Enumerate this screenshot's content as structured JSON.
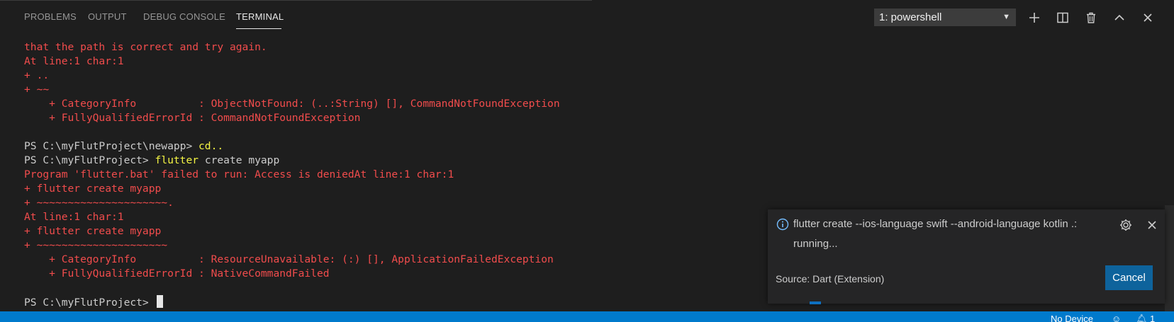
{
  "panel": {
    "tabs": [
      {
        "label": "PROBLEMS"
      },
      {
        "label": "OUTPUT"
      },
      {
        "label": "DEBUG CONSOLE"
      },
      {
        "label": "TERMINAL",
        "active": true
      }
    ],
    "terminal_select": {
      "value": "1: powershell"
    },
    "toolbar_icons": [
      "plus-icon",
      "split-icon",
      "trash-icon",
      "chevron-up-icon",
      "close-icon"
    ]
  },
  "terminal": {
    "lines": [
      {
        "parts": [
          {
            "text": "that the path is correct and try again.",
            "color": "red"
          }
        ]
      },
      {
        "parts": [
          {
            "text": "At line:1 char:1",
            "color": "red"
          }
        ]
      },
      {
        "parts": [
          {
            "text": "+ ..",
            "color": "red"
          }
        ]
      },
      {
        "parts": [
          {
            "text": "+ ~~",
            "color": "red"
          }
        ]
      },
      {
        "parts": [
          {
            "text": "    + CategoryInfo          : ObjectNotFound: (..:String) [], CommandNotFoundException",
            "color": "red"
          }
        ]
      },
      {
        "parts": [
          {
            "text": "    + FullyQualifiedErrorId : CommandNotFoundException",
            "color": "red"
          }
        ]
      },
      {
        "parts": [
          {
            "text": "",
            "color": "white"
          }
        ]
      },
      {
        "parts": [
          {
            "text": "PS C:\\myFlutProject\\newapp> ",
            "color": "white"
          },
          {
            "text": "cd..",
            "color": "yellow"
          }
        ]
      },
      {
        "parts": [
          {
            "text": "PS C:\\myFlutProject> ",
            "color": "white"
          },
          {
            "text": "flutter",
            "color": "yellow"
          },
          {
            "text": " create myapp",
            "color": "white"
          }
        ]
      },
      {
        "parts": [
          {
            "text": "Program 'flutter.bat' failed to run: Access is deniedAt line:1 char:1",
            "color": "red"
          }
        ]
      },
      {
        "parts": [
          {
            "text": "+ flutter create myapp",
            "color": "red"
          }
        ]
      },
      {
        "parts": [
          {
            "text": "+ ~~~~~~~~~~~~~~~~~~~~~.",
            "color": "red"
          }
        ]
      },
      {
        "parts": [
          {
            "text": "At line:1 char:1",
            "color": "red"
          }
        ]
      },
      {
        "parts": [
          {
            "text": "+ flutter create myapp",
            "color": "red"
          }
        ]
      },
      {
        "parts": [
          {
            "text": "+ ~~~~~~~~~~~~~~~~~~~~~",
            "color": "red"
          }
        ]
      },
      {
        "parts": [
          {
            "text": "    + CategoryInfo          : ResourceUnavailable: (:) [], ApplicationFailedException",
            "color": "red"
          }
        ]
      },
      {
        "parts": [
          {
            "text": "    + FullyQualifiedErrorId : NativeCommandFailed",
            "color": "red"
          }
        ]
      },
      {
        "parts": [
          {
            "text": "",
            "color": "white"
          }
        ]
      },
      {
        "parts": [
          {
            "text": "PS C:\\myFlutProject> ",
            "color": "white"
          }
        ],
        "cursor": true
      }
    ]
  },
  "notification": {
    "icon": "info-icon",
    "message": "flutter create --ios-language swift --android-language kotlin .:",
    "message_cont": "running...",
    "source": "Source: Dart (Extension)",
    "cancel_label": "Cancel"
  },
  "statusbar": {
    "device": "No Device",
    "notifications_count": "1"
  },
  "colors": {
    "panel_bg": "#1e1e1e",
    "error_red": "#f14c4c",
    "command_yellow": "#f5f543",
    "statusbar_blue": "#007acc",
    "button_blue": "#0e639c"
  }
}
